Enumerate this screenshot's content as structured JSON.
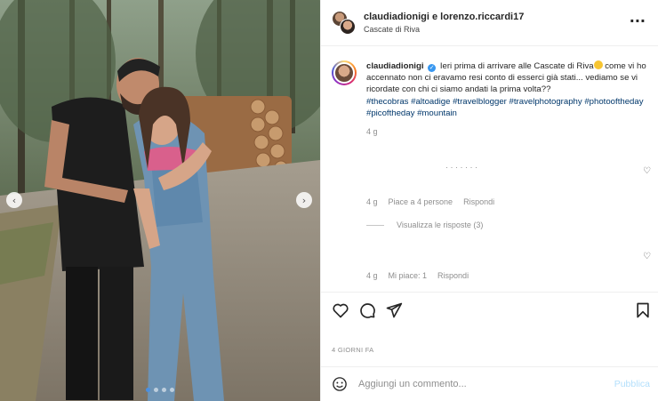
{
  "post": {
    "header": {
      "users": "claudiadionigi e lorenzo.riccardi17",
      "location": "Cascate di Riva",
      "more_icon": "more-horizontal-icon"
    },
    "caption": {
      "username": "claudiadionigi",
      "text": "Ieri prima di arrivare alle Cascate di Riva",
      "text_cont": " come vi ho accennato non ci eravamo resi conto di esserci già stati... vediamo se vi ricordate con chi ci siamo andati la prima volta??",
      "hashtags": "#thecobras #altoadige #travelblogger #travelphotography #photooftheday #picoftheday #mountain",
      "time": "4 g"
    },
    "comment_ghost": "· · · · · · ·",
    "comment1": {
      "time": "4 g",
      "likes": "Piace a 4 persone",
      "reply": "Rispondi"
    },
    "view_replies": "Visualizza le risposte (3)",
    "comment2": {
      "time": "4 g",
      "likes": "Mi piace: 1",
      "reply": "Rispondi"
    },
    "date_label": "4 GIORNI FA",
    "add_comment": {
      "placeholder": "Aggiungi un commento...",
      "publish": "Pubblica"
    },
    "carousel": {
      "slides": 4,
      "active_index": 0
    },
    "colors": {
      "link": "#00376b",
      "muted": "#8e8e8e",
      "publish_disabled": "#b2dffc",
      "carousel_active": "#4a90e2"
    }
  }
}
